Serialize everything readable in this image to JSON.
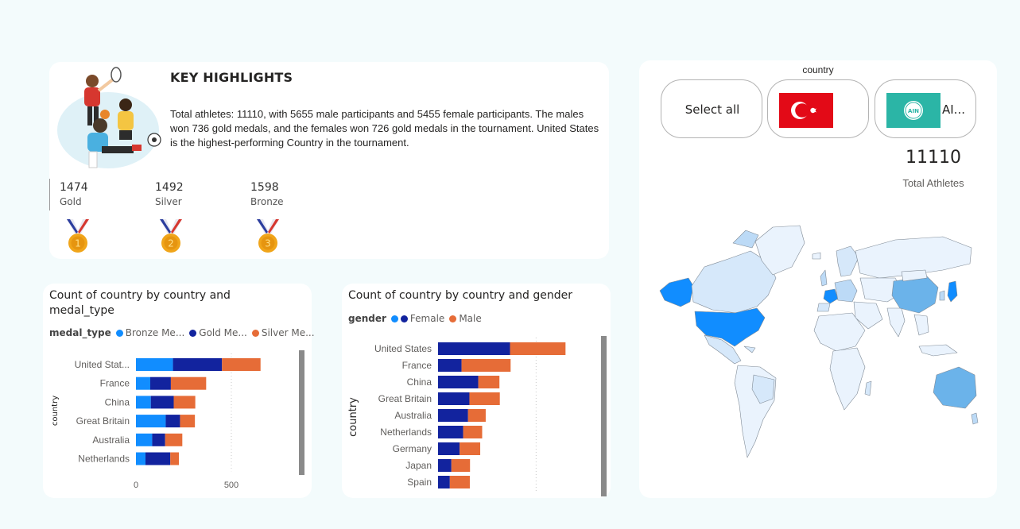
{
  "highlights": {
    "title": "KEY HIGHLIGHTS",
    "text": "Total athletes: 11110, with 5655 male participants and 5455 female participants. The males won 736 gold medals, and the females won 726 gold medals in the tournament. United States is the highest-performing Country in the tournament.",
    "medals": [
      {
        "value": "1474",
        "label": "Gold",
        "number": "1",
        "icon": "gold-medal-icon"
      },
      {
        "value": "1492",
        "label": "Silver",
        "number": "2",
        "icon": "silver-medal-icon"
      },
      {
        "value": "1598",
        "label": "Bronze",
        "number": "3",
        "icon": "bronze-medal-icon"
      }
    ]
  },
  "slicer": {
    "title": "country",
    "tiles": [
      {
        "label": "Select all"
      },
      {
        "label": "",
        "icon": "turkey-flag-icon"
      },
      {
        "label": "AI...",
        "icon": "ain-flag-icon",
        "badge": "AIN"
      }
    ]
  },
  "kpi": {
    "value": "11110",
    "label": "Total Athletes"
  },
  "colors": {
    "bronze": "#118dff",
    "gold": "#12239e",
    "silver": "#e66c37",
    "female": "#12239e",
    "male": "#e66c37"
  },
  "chart_data": [
    {
      "type": "bar",
      "orientation": "horizontal",
      "stacked": true,
      "title": "Count of country by country and medal_type",
      "legend_title": "medal_type",
      "ylabel": "country",
      "categories": [
        "United Stat...",
        "France",
        "China",
        "Great Britain",
        "Australia",
        "Netherlands"
      ],
      "series": [
        {
          "name": "Bronze Me...",
          "values": [
            194,
            75,
            78,
            156,
            85,
            50
          ]
        },
        {
          "name": "Gold Me...",
          "values": [
            257,
            108,
            120,
            75,
            68,
            130
          ]
        },
        {
          "name": "Silver Me...",
          "values": [
            202,
            185,
            113,
            78,
            90,
            45
          ]
        }
      ],
      "xticks": [
        "0",
        "500"
      ],
      "xlim": [
        0,
        750
      ],
      "legend_position": "top-left",
      "grid": true
    },
    {
      "type": "bar",
      "orientation": "horizontal",
      "stacked": true,
      "title": "Count of country by country and gender",
      "legend_title": "gender",
      "ylabel": "country",
      "categories": [
        "United States",
        "France",
        "China",
        "Great Britain",
        "Australia",
        "Netherlands",
        "Germany",
        "Japan",
        "Spain"
      ],
      "series": [
        {
          "name": "Female",
          "values": [
            367,
            120,
            205,
            160,
            153,
            128,
            110,
            68,
            60
          ]
        },
        {
          "name": "Male",
          "values": [
            283,
            250,
            108,
            155,
            90,
            97,
            105,
            95,
            102
          ]
        }
      ],
      "xticks": [
        "0",
        "500"
      ],
      "xlim": [
        0,
        750
      ],
      "legend_position": "top-left",
      "grid": true
    }
  ]
}
